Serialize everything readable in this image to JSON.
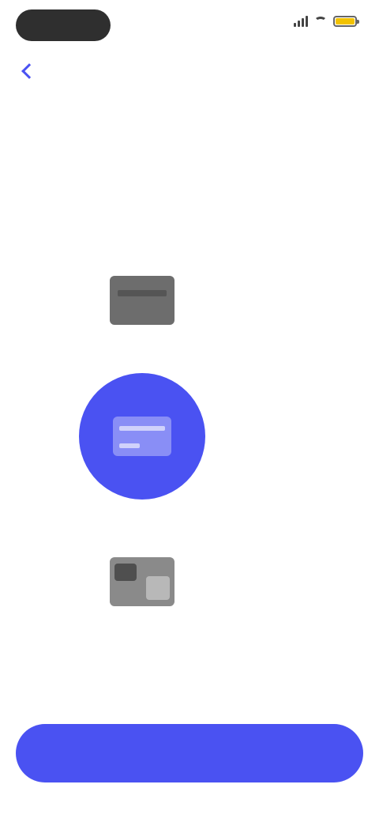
{
  "status_bar": {
    "time": "",
    "battery_color": "#f2c200"
  },
  "header": {
    "back_icon": "chevron-left-icon",
    "back_label": "",
    "title": ""
  },
  "options": [
    {
      "icon": "card-icon",
      "label": "",
      "selected": false
    },
    {
      "icon": "bank-icon",
      "label": "",
      "selected": true
    },
    {
      "icon": "wallet-icon",
      "label": "",
      "selected": false
    }
  ],
  "footer": {
    "continue_label": ""
  },
  "colors": {
    "accent": "#4a52f2",
    "text": "#2b2b2b",
    "background": "#ffffff"
  }
}
